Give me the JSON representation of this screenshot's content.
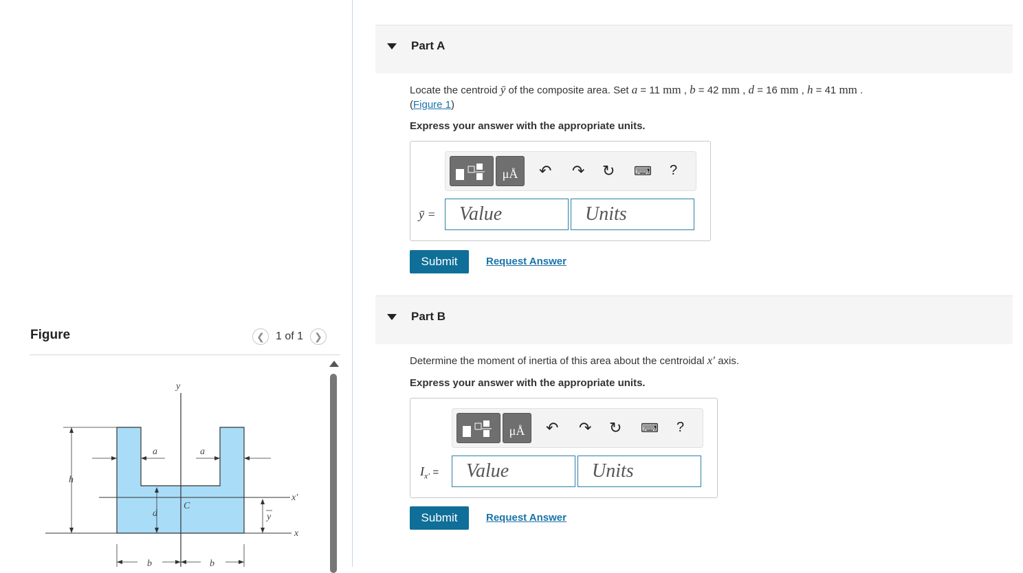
{
  "figure_panel": {
    "title": "Figure",
    "pager_text": "1 of 1",
    "prev_icon": "chevron-left-icon",
    "next_icon": "chevron-right-icon",
    "labels": {
      "y": "y",
      "a_left": "a",
      "a_right": "a",
      "h": "h",
      "d": "d",
      "C": "C",
      "ybar": "y",
      "x_prime": "x′",
      "x": "x",
      "b_left": "b",
      "b_right": "b"
    },
    "fill_color": "#a9dcf7"
  },
  "part_a": {
    "label": "Part A",
    "prompt_1": "Locate the centroid",
    "symbol": "ȳ",
    "prompt_2": "of the composite area. Set",
    "params": [
      {
        "var": "a",
        "val": "11",
        "unit": "mm",
        "sep": " ,"
      },
      {
        "var": "b",
        "val": "42",
        "unit": "mm",
        "sep": " ,"
      },
      {
        "var": "d",
        "val": "16",
        "unit": "mm",
        "sep": " ,"
      },
      {
        "var": "h",
        "val": "41",
        "unit": "mm",
        "sep": " ."
      }
    ],
    "figure_link_open": "(",
    "figure_link": "Figure 1",
    "figure_link_close": ")",
    "instruction": "Express your answer with the appropriate units.",
    "eq_label": "ȳ =",
    "value_placeholder": "Value",
    "units_placeholder": "Units",
    "submit": "Submit",
    "request": "Request Answer"
  },
  "part_b": {
    "label": "Part B",
    "prompt_1": "Determine the moment of inertia of this area about the centroidal",
    "symbol": "x′",
    "prompt_2": "axis.",
    "instruction": "Express your answer with the appropriate units.",
    "eq_label_main": "I",
    "eq_label_sub": "x′",
    "eq_label_eq": "=",
    "value_placeholder": "Value",
    "units_placeholder": "Units",
    "submit": "Submit",
    "request": "Request Answer"
  },
  "toolbar": {
    "templates_icon": "fraction-template-icon",
    "units_btn": "μÅ",
    "undo_icon": "undo-icon",
    "redo_icon": "redo-icon",
    "reset_icon": "reset-icon",
    "keyboard_icon": "keyboard-icon",
    "help": "?"
  },
  "colors": {
    "submit_bg": "#0f6f98",
    "link": "#1a73a8",
    "field_border": "#2a7fa6"
  }
}
